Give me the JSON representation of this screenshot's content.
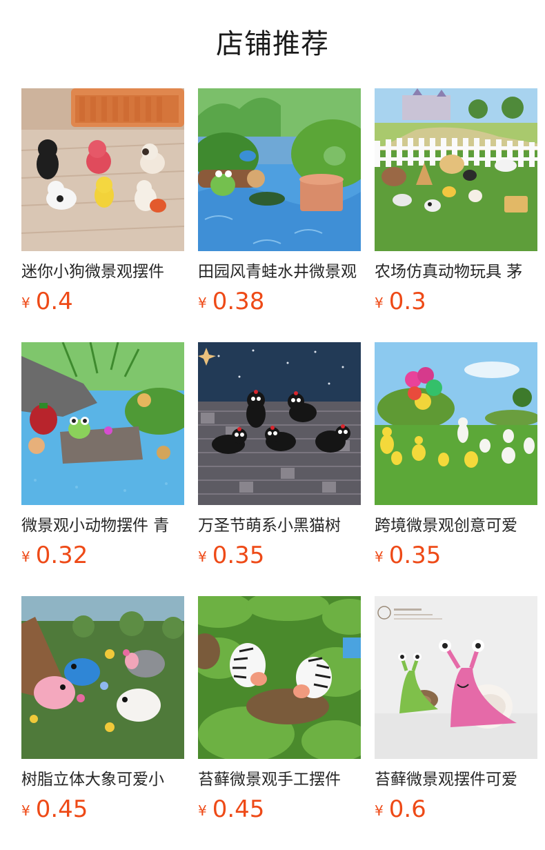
{
  "section": {
    "title": "店铺推荐"
  },
  "products": [
    {
      "name": "迷你小狗微景观摆件",
      "currency": "¥",
      "price": "0.4"
    },
    {
      "name": "田园风青蛙水井微景观",
      "currency": "¥",
      "price": "0.38"
    },
    {
      "name": "农场仿真动物玩具 茅",
      "currency": "¥",
      "price": "0.3"
    },
    {
      "name": "微景观小动物摆件 青",
      "currency": "¥",
      "price": "0.32"
    },
    {
      "name": "万圣节萌系小黑猫树",
      "currency": "¥",
      "price": "0.35"
    },
    {
      "name": "跨境微景观创意可爱",
      "currency": "¥",
      "price": "0.35"
    },
    {
      "name": "树脂立体大象可爱小",
      "currency": "¥",
      "price": "0.45"
    },
    {
      "name": "苔藓微景观手工摆件",
      "currency": "¥",
      "price": "0.45"
    },
    {
      "name": "苔藓微景观摆件可爱",
      "currency": "¥",
      "price": "0.6"
    }
  ],
  "image_icons": [
    "dogs-figurines-photo",
    "frog-well-pond-photo",
    "farm-animals-fence-photo",
    "frog-snails-rock-photo",
    "black-cats-cobblestone-photo",
    "ducks-balloons-lawn-photo",
    "elephants-flowers-moss-photo",
    "zebras-moss-photo",
    "snails-figurines-photo"
  ],
  "colors": {
    "price": "#ee4a17",
    "title": "#1a1a1a",
    "text": "#262626"
  }
}
